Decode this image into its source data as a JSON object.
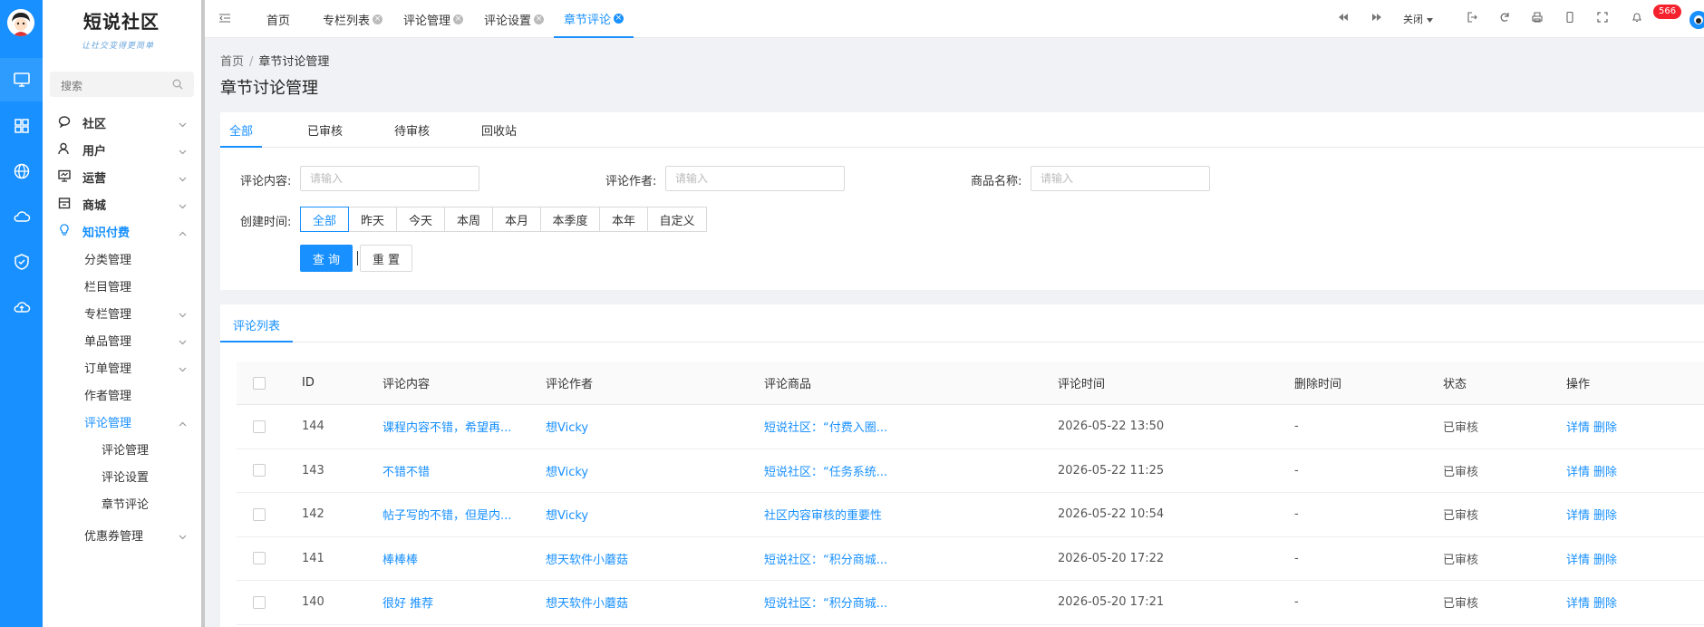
{
  "sidebar": {
    "logo_title": "短说社区",
    "logo_subtitle": "让社交变得更简单",
    "search_placeholder": "搜索",
    "menu": [
      {
        "label": "社区"
      },
      {
        "label": "用户"
      },
      {
        "label": "运营"
      },
      {
        "label": "商城"
      },
      {
        "label": "知识付费"
      }
    ],
    "submenu": [
      {
        "label": "分类管理"
      },
      {
        "label": "栏目管理"
      },
      {
        "label": "专栏管理"
      },
      {
        "label": "单品管理"
      },
      {
        "label": "订单管理"
      },
      {
        "label": "作者管理"
      },
      {
        "label": "评论管理"
      }
    ],
    "submenu2": [
      {
        "label": "评论管理"
      },
      {
        "label": "评论设置"
      },
      {
        "label": "章节评论"
      }
    ],
    "submenu_after": {
      "label": "优惠券管理"
    }
  },
  "topbar": {
    "tabs": [
      {
        "label": "首页"
      },
      {
        "label": "专栏列表"
      },
      {
        "label": "评论管理"
      },
      {
        "label": "评论设置"
      },
      {
        "label": "章节评论"
      }
    ],
    "close_label": "关闭",
    "notification_count": "566"
  },
  "breadcrumb": {
    "home": "首页",
    "separator": "/",
    "current": "章节讨论管理"
  },
  "page_title": "章节讨论管理",
  "status_tabs": [
    {
      "label": "全部"
    },
    {
      "label": "已审核"
    },
    {
      "label": "待审核"
    },
    {
      "label": "回收站"
    }
  ],
  "filters": {
    "content_label": "评论内容:",
    "author_label": "评论作者:",
    "product_label": "商品名称:",
    "placeholder": "请输入",
    "date_label": "创建时间:",
    "date_options": [
      "全部",
      "昨天",
      "今天",
      "本周",
      "本月",
      "本季度",
      "本年",
      "自定义"
    ],
    "query_label": "查 询",
    "reset_label": "重 置"
  },
  "list": {
    "tab_label": "评论列表",
    "columns": [
      "ID",
      "评论内容",
      "评论作者",
      "评论商品",
      "评论时间",
      "删除时间",
      "状态",
      "操作"
    ],
    "rows": [
      {
        "id": "144",
        "content": "课程内容不错，希望再...",
        "author": "想Vicky",
        "product": "短说社区：“付费入圈...",
        "time": "2026-05-22 13:50",
        "deleted": "-",
        "status": "已审核",
        "op_detail": "详情",
        "op_delete": "删除"
      },
      {
        "id": "143",
        "content": "不错不错",
        "author": "想Vicky",
        "product": "短说社区：“任务系统...",
        "time": "2026-05-22 11:25",
        "deleted": "-",
        "status": "已审核",
        "op_detail": "详情",
        "op_delete": "删除"
      },
      {
        "id": "142",
        "content": "帖子写的不错，但是内...",
        "author": "想Vicky",
        "product": "社区内容审核的重要性",
        "time": "2026-05-22 10:54",
        "deleted": "-",
        "status": "已审核",
        "op_detail": "详情",
        "op_delete": "删除"
      },
      {
        "id": "141",
        "content": "棒棒棒",
        "author": "想天软件小蘑菇",
        "product": "短说社区：“积分商城...",
        "time": "2026-05-20 17:22",
        "deleted": "-",
        "status": "已审核",
        "op_detail": "详情",
        "op_delete": "删除"
      },
      {
        "id": "140",
        "content": "很好 推荐",
        "author": "想天软件小蘑菇",
        "product": "短说社区：“积分商城...",
        "time": "2026-05-20 17:21",
        "deleted": "-",
        "status": "已审核",
        "op_detail": "详情",
        "op_delete": "删除"
      }
    ]
  },
  "colors": {
    "primary": "#1890ff",
    "badge": "#f5222d"
  }
}
